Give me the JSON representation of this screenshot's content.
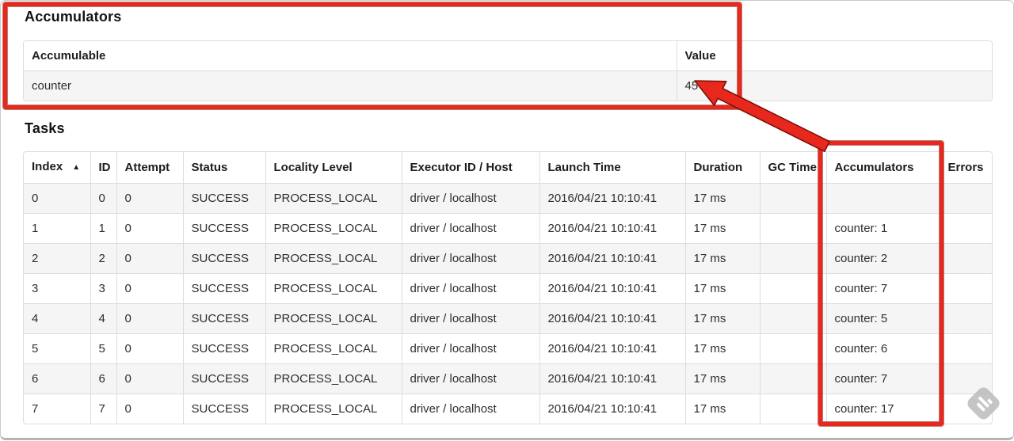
{
  "accumulators_section": {
    "title": "Accumulators",
    "table": {
      "headers": [
        "Accumulable",
        "Value"
      ],
      "rows": [
        [
          "counter",
          "45"
        ]
      ]
    }
  },
  "tasks_section": {
    "title": "Tasks",
    "table": {
      "headers": [
        "Index",
        "ID",
        "Attempt",
        "Status",
        "Locality Level",
        "Executor ID / Host",
        "Launch Time",
        "Duration",
        "GC Time",
        "Accumulators",
        "Errors"
      ],
      "sorted_column": "Index",
      "sort_icon": "▲",
      "rows": [
        [
          "0",
          "0",
          "0",
          "SUCCESS",
          "PROCESS_LOCAL",
          "driver / localhost",
          "2016/04/21 10:10:41",
          "17 ms",
          "",
          "",
          ""
        ],
        [
          "1",
          "1",
          "0",
          "SUCCESS",
          "PROCESS_LOCAL",
          "driver / localhost",
          "2016/04/21 10:10:41",
          "17 ms",
          "",
          "counter: 1",
          ""
        ],
        [
          "2",
          "2",
          "0",
          "SUCCESS",
          "PROCESS_LOCAL",
          "driver / localhost",
          "2016/04/21 10:10:41",
          "17 ms",
          "",
          "counter: 2",
          ""
        ],
        [
          "3",
          "3",
          "0",
          "SUCCESS",
          "PROCESS_LOCAL",
          "driver / localhost",
          "2016/04/21 10:10:41",
          "17 ms",
          "",
          "counter: 7",
          ""
        ],
        [
          "4",
          "4",
          "0",
          "SUCCESS",
          "PROCESS_LOCAL",
          "driver / localhost",
          "2016/04/21 10:10:41",
          "17 ms",
          "",
          "counter: 5",
          ""
        ],
        [
          "5",
          "5",
          "0",
          "SUCCESS",
          "PROCESS_LOCAL",
          "driver / localhost",
          "2016/04/21 10:10:41",
          "17 ms",
          "",
          "counter: 6",
          ""
        ],
        [
          "6",
          "6",
          "0",
          "SUCCESS",
          "PROCESS_LOCAL",
          "driver / localhost",
          "2016/04/21 10:10:41",
          "17 ms",
          "",
          "counter: 7",
          ""
        ],
        [
          "7",
          "7",
          "0",
          "SUCCESS",
          "PROCESS_LOCAL",
          "driver / localhost",
          "2016/04/21 10:10:41",
          "17 ms",
          "",
          "counter: 17",
          ""
        ]
      ]
    }
  },
  "annotations": {
    "highlight_color": "#e8281d",
    "outline_color": "#7e1208",
    "shapes": [
      "box-around-accumulators-summary",
      "arrow-pointing-to-value-45",
      "box-around-accumulators-column"
    ]
  },
  "colors": {
    "table_border": "#dddddd",
    "row_stripe": "#f5f5f5",
    "text": "#2e2e2e"
  },
  "watermark_icon": "skitch-watermark"
}
